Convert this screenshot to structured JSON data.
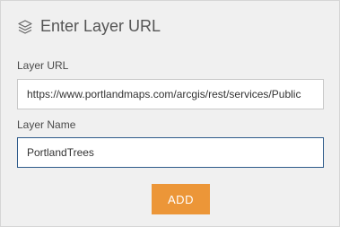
{
  "header": {
    "icon": "layers-icon",
    "title": "Enter Layer URL"
  },
  "fields": {
    "url_label": "Layer URL",
    "url_value": "https://www.portlandmaps.com/arcgis/rest/services/Public",
    "name_label": "Layer Name",
    "name_value": "PortlandTrees"
  },
  "actions": {
    "add_label": "ADD"
  },
  "colors": {
    "accent": "#ec9638",
    "focus_border": "#2e5b8a"
  }
}
